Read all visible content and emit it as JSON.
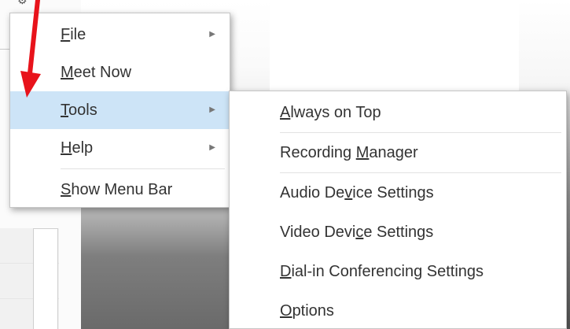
{
  "main_menu": {
    "items": [
      {
        "label": "File",
        "mnemonic_index": 0,
        "has_submenu": true,
        "highlighted": false
      },
      {
        "label": "Meet Now",
        "mnemonic_index": 0,
        "has_submenu": false,
        "highlighted": false
      },
      {
        "label": "Tools",
        "mnemonic_index": 0,
        "has_submenu": true,
        "highlighted": true
      },
      {
        "label": "Help",
        "mnemonic_index": 0,
        "has_submenu": true,
        "highlighted": false
      },
      {
        "label": "Show Menu Bar",
        "mnemonic_index": 0,
        "has_submenu": false,
        "highlighted": false
      }
    ]
  },
  "tools_submenu": {
    "items": [
      {
        "label": "Always on Top",
        "mnemonic_index": 0
      },
      {
        "label": "Recording Manager",
        "mnemonic_index": 10
      },
      {
        "label": "Audio Device Settings",
        "mnemonic_index": 8
      },
      {
        "label": "Video Device Settings",
        "mnemonic_index": 10
      },
      {
        "label": "Dial-in Conferencing Settings",
        "mnemonic_index": 0
      },
      {
        "label": "Options",
        "mnemonic_index": 0
      }
    ]
  },
  "colors": {
    "highlight": "#cde4f7",
    "annotation_arrow": "#e8131b"
  },
  "icons": {
    "submenu_arrow": "submenu-arrow-icon",
    "gear": "gear-icon",
    "meet_now": "meet-now-icon"
  }
}
